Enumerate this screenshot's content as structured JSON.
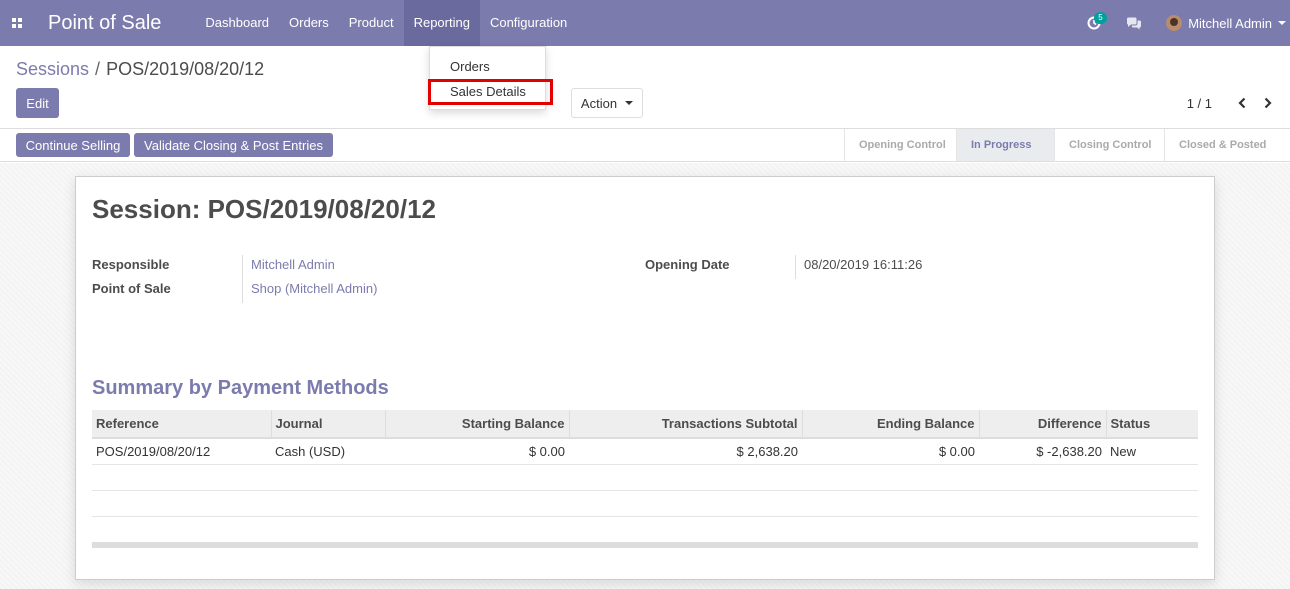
{
  "navbar": {
    "brand": "Point of Sale",
    "menu": [
      "Dashboard",
      "Orders",
      "Product",
      "Reporting",
      "Configuration"
    ],
    "activity_count": "5",
    "user_name": "Mitchell Admin"
  },
  "breadcrumb": {
    "parent": "Sessions",
    "separator": "/",
    "current": "POS/2019/08/20/12"
  },
  "buttons": {
    "edit": "Edit",
    "action": "Action",
    "continue_selling": "Continue Selling",
    "validate": "Validate Closing & Post Entries"
  },
  "pager": {
    "value": "1 / 1"
  },
  "reporting_dropdown": {
    "items": [
      "Orders",
      "Sales Details"
    ]
  },
  "stages": [
    "Opening Control",
    "In Progress",
    "Closing Control",
    "Closed & Posted"
  ],
  "form": {
    "title": "Session: POS/2019/08/20/12",
    "responsible_label": "Responsible",
    "responsible_value": "Mitchell Admin",
    "pos_label": "Point of Sale",
    "pos_value": "Shop (Mitchell Admin)",
    "opening_date_label": "Opening Date",
    "opening_date_value": "08/20/2019 16:11:26",
    "summary_title": "Summary by Payment Methods"
  },
  "table": {
    "headers": [
      "Reference",
      "Journal",
      "Starting Balance",
      "Transactions Subtotal",
      "Ending Balance",
      "Difference",
      "Status"
    ],
    "rows": [
      [
        "POS/2019/08/20/12",
        "Cash (USD)",
        "$ 0.00",
        "$ 2,638.20",
        "$ 0.00",
        "$ -2,638.20",
        "New"
      ]
    ]
  },
  "colors": {
    "brand": "#7c7bad",
    "highlight": "#e30000",
    "badge": "#00a09d"
  }
}
